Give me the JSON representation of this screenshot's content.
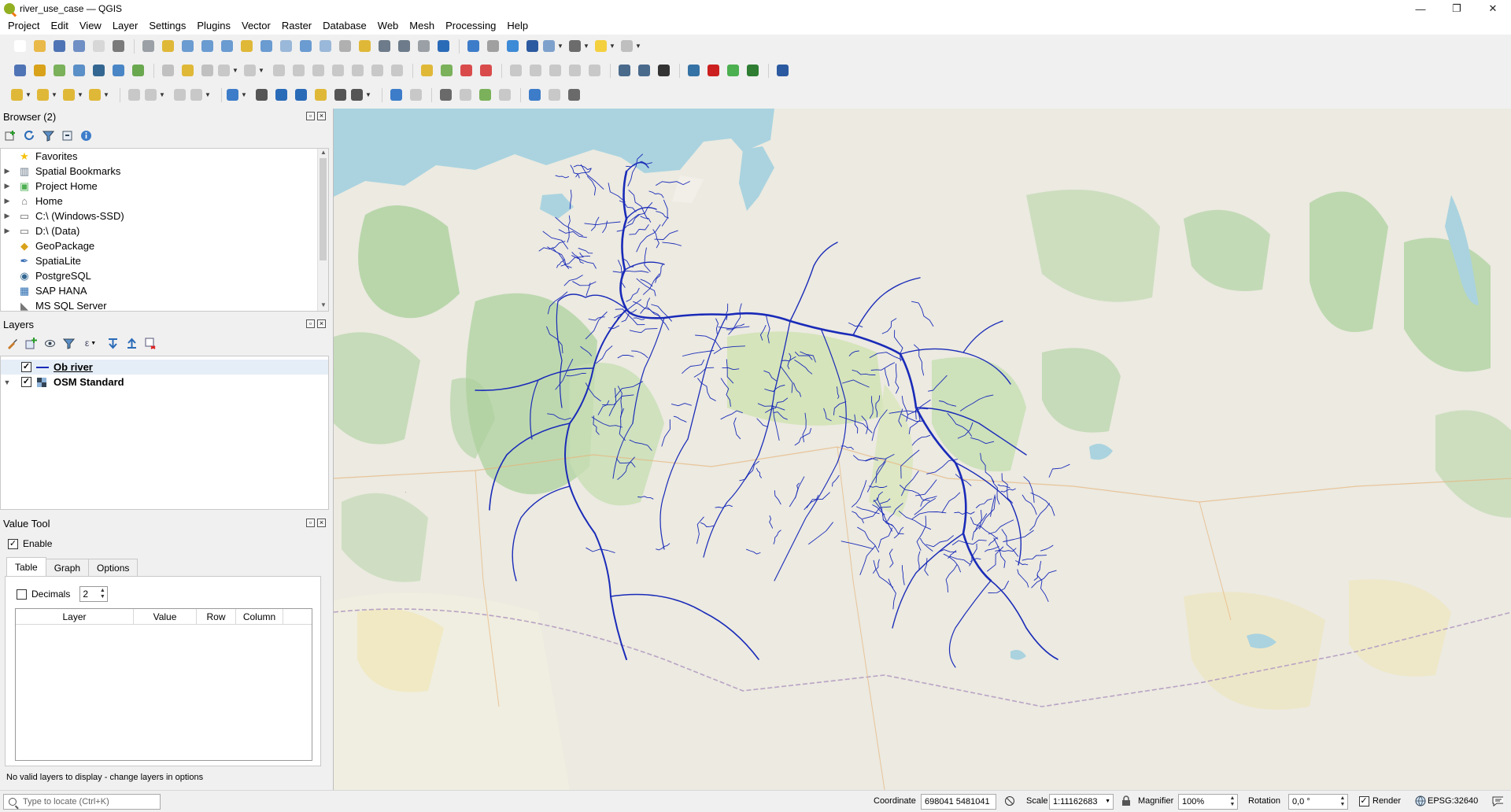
{
  "window": {
    "title": "river_use_case — QGIS",
    "buttons": [
      "—",
      "❐",
      "✕"
    ]
  },
  "menubar": [
    "Project",
    "Edit",
    "View",
    "Layer",
    "Settings",
    "Plugins",
    "Vector",
    "Raster",
    "Database",
    "Web",
    "Mesh",
    "Processing",
    "Help"
  ],
  "browser": {
    "title": "Browser (2)",
    "items": [
      {
        "label": "Favorites",
        "icon": "star-icon",
        "expandable": false
      },
      {
        "label": "Spatial Bookmarks",
        "icon": "bookmark-icon",
        "expandable": true
      },
      {
        "label": "Project Home",
        "icon": "project-home-icon",
        "expandable": true
      },
      {
        "label": "Home",
        "icon": "home-folder-icon",
        "expandable": true
      },
      {
        "label": "C:\\ (Windows-SSD)",
        "icon": "drive-icon",
        "expandable": true
      },
      {
        "label": "D:\\ (Data)",
        "icon": "drive-icon",
        "expandable": true
      },
      {
        "label": "GeoPackage",
        "icon": "geopackage-icon",
        "expandable": false
      },
      {
        "label": "SpatiaLite",
        "icon": "spatialite-icon",
        "expandable": false
      },
      {
        "label": "PostgreSQL",
        "icon": "postgresql-icon",
        "expandable": false
      },
      {
        "label": "SAP HANA",
        "icon": "sap-hana-icon",
        "expandable": false
      },
      {
        "label": "MS SQL Server",
        "icon": "mssql-icon",
        "expandable": false
      }
    ]
  },
  "layers": {
    "title": "Layers",
    "items": [
      {
        "label": "Ob river",
        "checked": true,
        "type": "line"
      },
      {
        "label": "OSM Standard",
        "checked": true,
        "type": "raster"
      }
    ]
  },
  "value_tool": {
    "title": "Value Tool",
    "enable_label": "Enable",
    "tabs": [
      "Table",
      "Graph",
      "Options"
    ],
    "decimals_label": "Decimals",
    "decimals_value": "2",
    "columns": [
      "Layer",
      "Value",
      "Row",
      "Column"
    ],
    "status": "No valid layers to display - change layers in options"
  },
  "statusbar": {
    "locator_placeholder": "Type to locate (Ctrl+K)",
    "coordinate_label": "Coordinate",
    "coordinate_value": "698041  5481041",
    "scale_label": "Scale",
    "scale_value": "1:11162683",
    "magnifier_label": "Magnifier",
    "magnifier_value": "100%",
    "rotation_label": "Rotation",
    "rotation_value": "0,0 °",
    "render_label": "Render",
    "crs": "EPSG:32640"
  },
  "colors": {
    "river": "#1a2bb8",
    "map_bg": "#eceae1",
    "forest": "#add19e",
    "water": "#aad3df",
    "qgis_green": "#93b023"
  }
}
